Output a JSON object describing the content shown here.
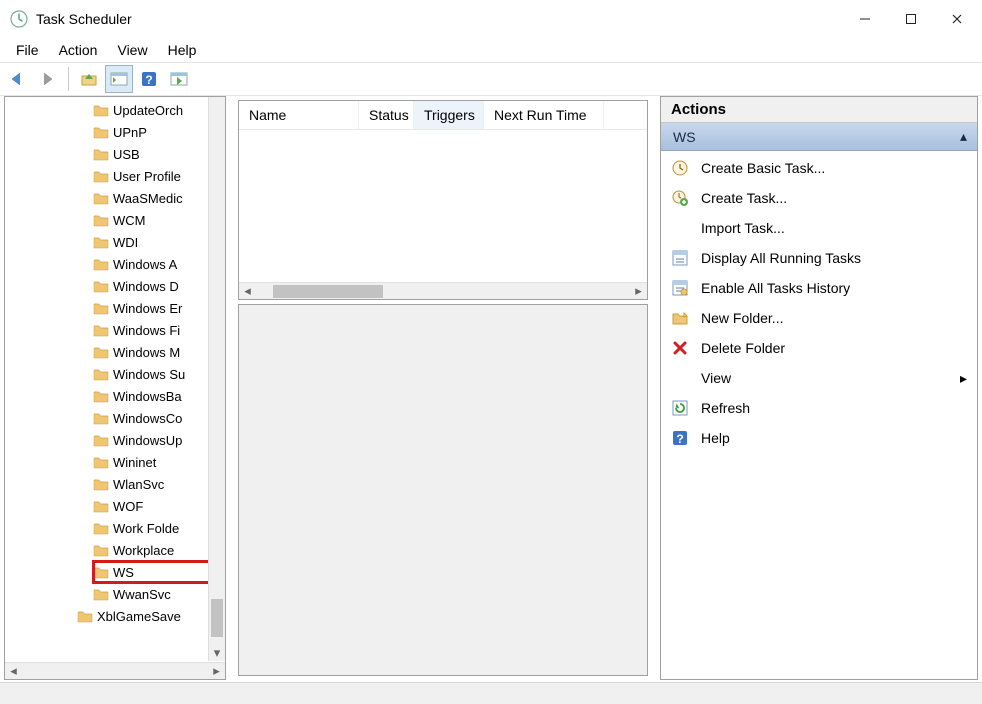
{
  "window": {
    "title": "Task Scheduler"
  },
  "menu": {
    "file": "File",
    "action": "Action",
    "view": "View",
    "help": "Help"
  },
  "tree": {
    "items": [
      "UpdateOrch",
      "UPnP",
      "USB",
      "User Profile",
      "WaaSMedic",
      "WCM",
      "WDI",
      "Windows A",
      "Windows D",
      "Windows Er",
      "Windows Fi",
      "Windows M",
      "Windows Su",
      "WindowsBa",
      "WindowsCo",
      "WindowsUp",
      "Wininet",
      "WlanSvc",
      "WOF",
      "Work Folde",
      "Workplace ",
      "WS",
      "WwanSvc"
    ],
    "outer_item": "XblGameSave",
    "selected_index": 21
  },
  "listview": {
    "columns": [
      "Name",
      "Status",
      "Triggers",
      "Next Run Time"
    ],
    "sorted_index": 2
  },
  "actions": {
    "header": "Actions",
    "group": "WS",
    "items": [
      {
        "icon": "clock",
        "label": "Create Basic Task..."
      },
      {
        "icon": "clock-plus",
        "label": "Create Task..."
      },
      {
        "icon": "none",
        "label": "Import Task..."
      },
      {
        "icon": "tasks",
        "label": "Display All Running Tasks"
      },
      {
        "icon": "history",
        "label": "Enable All Tasks History"
      },
      {
        "icon": "new-folder",
        "label": "New Folder..."
      },
      {
        "icon": "delete",
        "label": "Delete Folder"
      },
      {
        "icon": "none",
        "label": "View",
        "submenu": true
      },
      {
        "icon": "refresh",
        "label": "Refresh"
      },
      {
        "icon": "help",
        "label": "Help"
      }
    ]
  }
}
